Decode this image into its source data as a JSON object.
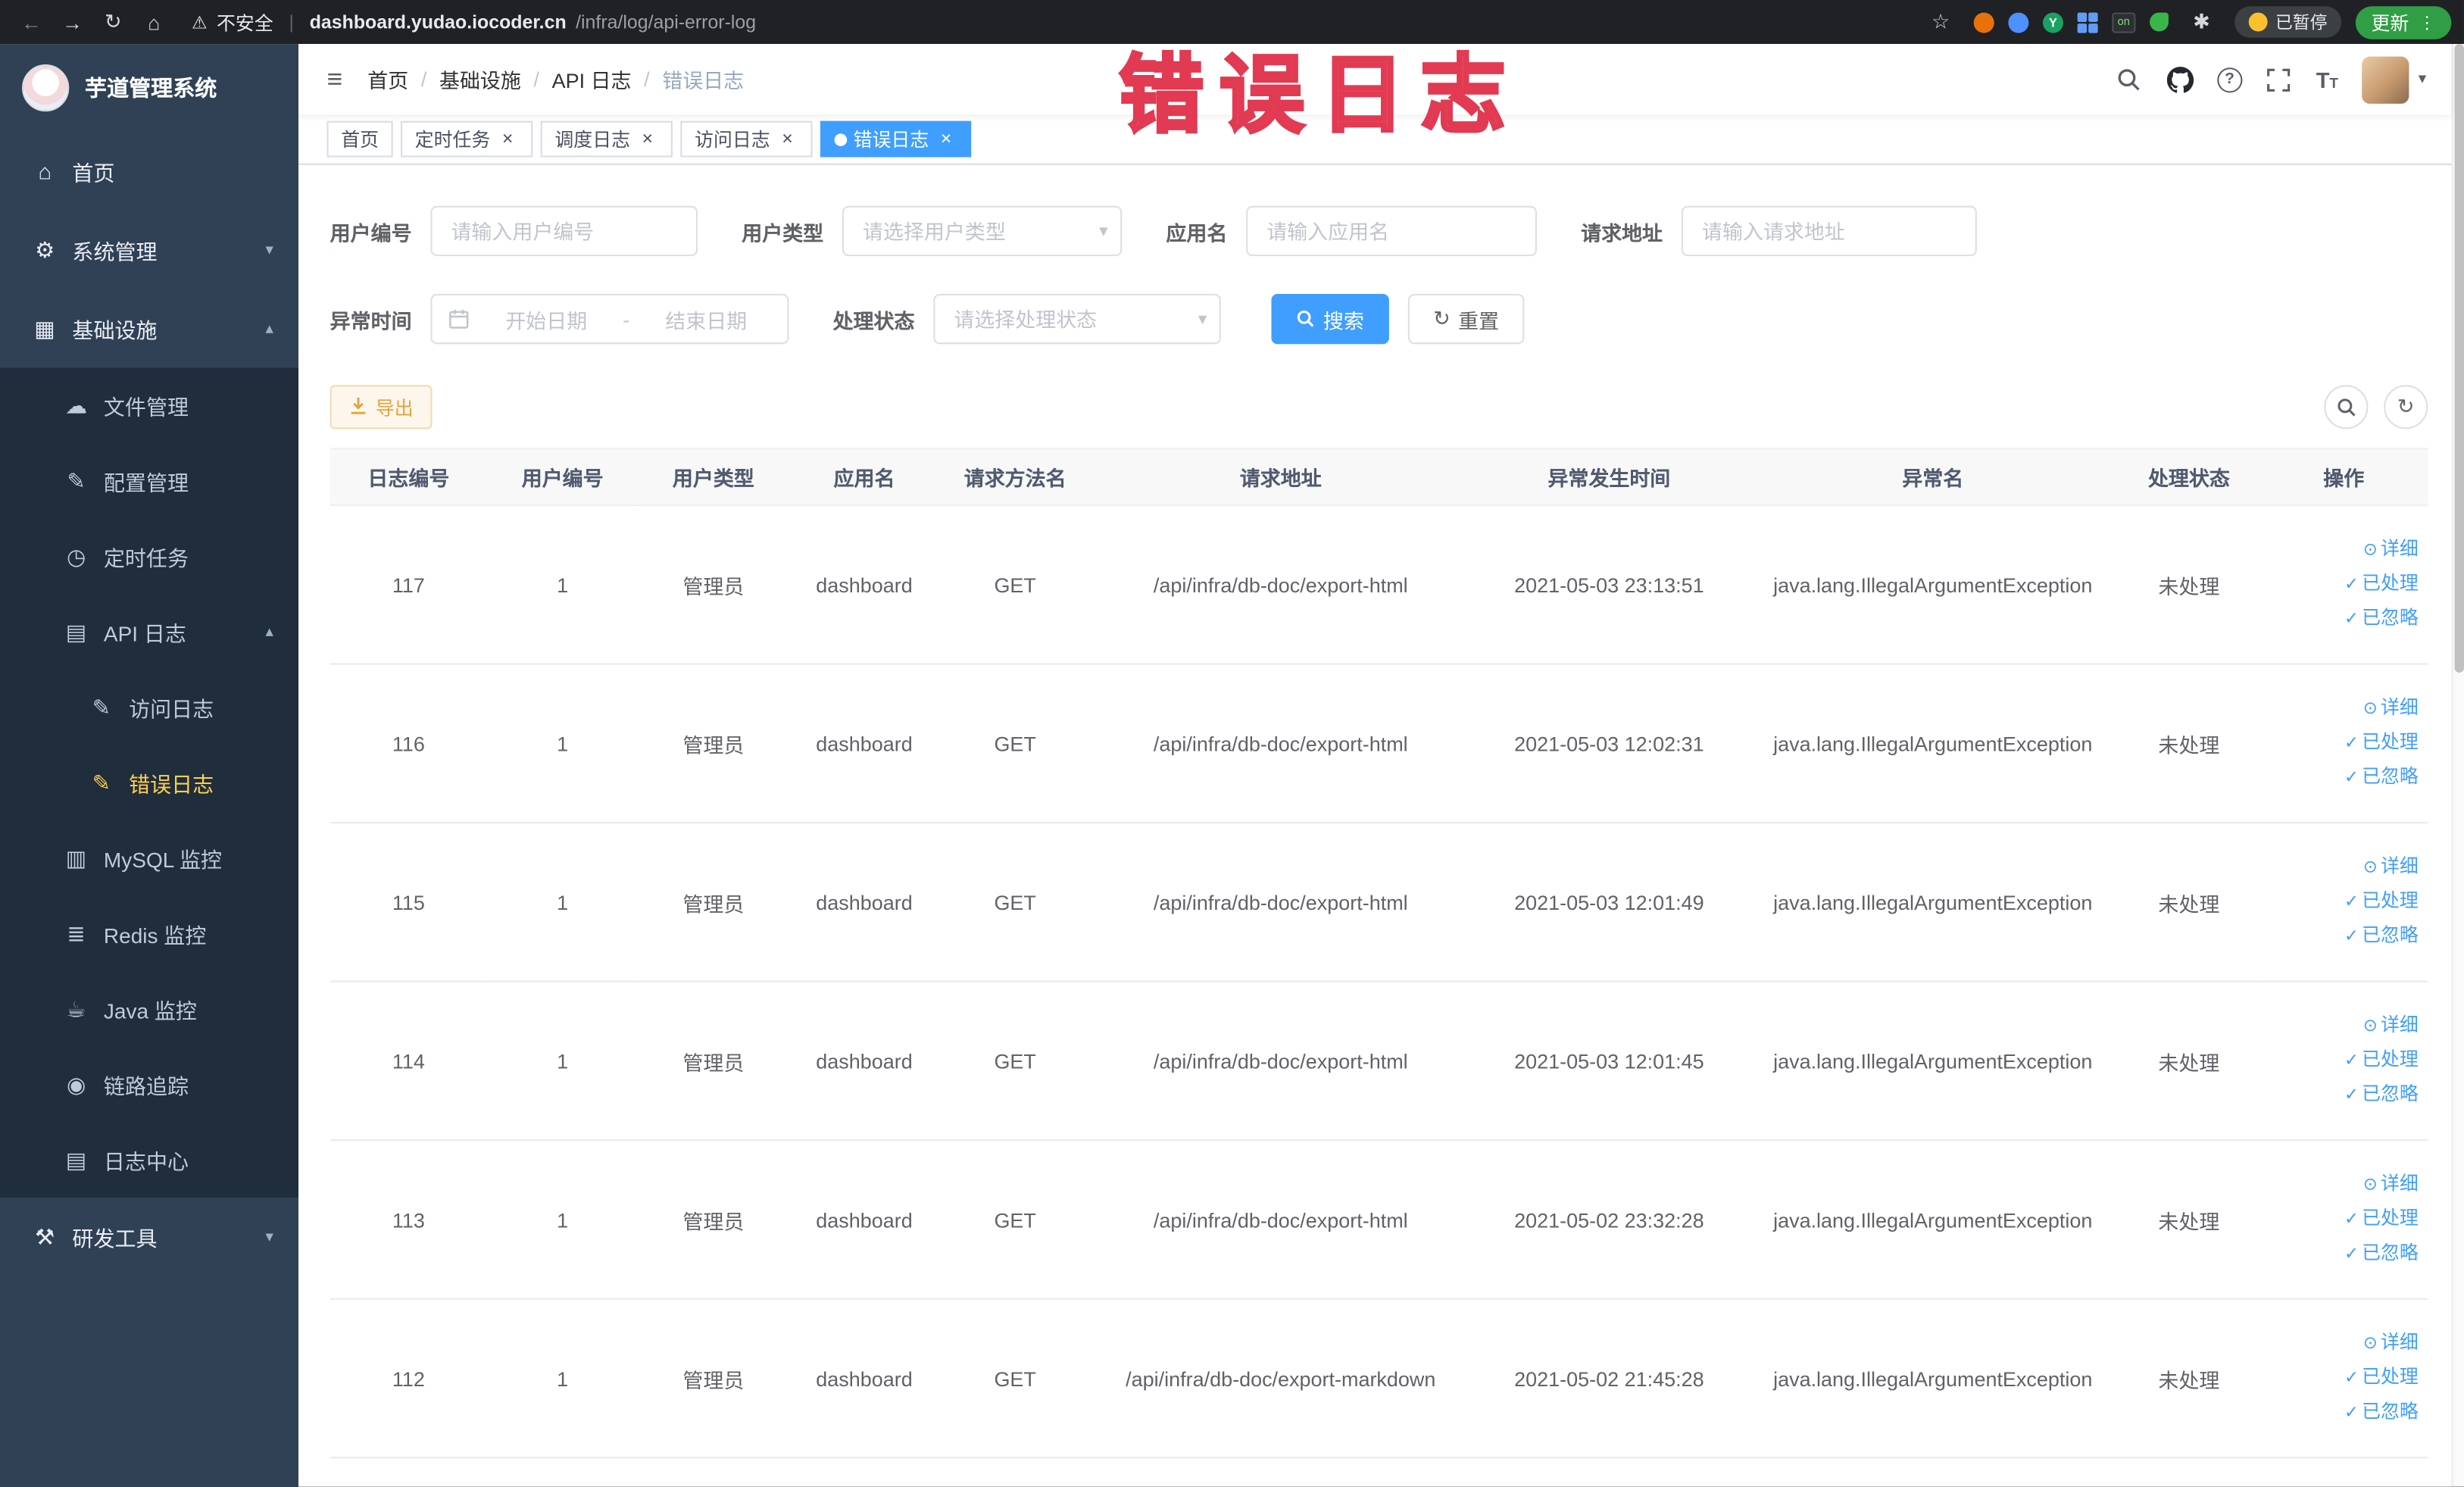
{
  "browser": {
    "security_label": "不安全",
    "divider": "|",
    "url_domain": "dashboard.yudao.iocoder.cn",
    "url_path": "/infra/log/api-error-log",
    "on_badge": "on",
    "paused_badge": "已暂停",
    "update_label": "更新"
  },
  "annotation": {
    "text": "错误日志"
  },
  "sidebar": {
    "logo_title": "芋道管理系统",
    "items": [
      {
        "name": "home",
        "label": "首页",
        "icon": "home-icon",
        "level": 1
      },
      {
        "name": "system-management",
        "label": "系统管理",
        "icon": "gear-icon",
        "level": 1,
        "arrow": "down"
      },
      {
        "name": "infrastructure",
        "label": "基础设施",
        "icon": "infra-icon",
        "level": 1,
        "arrow": "up"
      },
      {
        "name": "file-management",
        "label": "文件管理",
        "icon": "file-icon",
        "level": 2
      },
      {
        "name": "config-management",
        "label": "配置管理",
        "icon": "config-icon",
        "level": 2
      },
      {
        "name": "scheduled-jobs",
        "label": "定时任务",
        "icon": "job-icon",
        "level": 2
      },
      {
        "name": "api-log",
        "label": "API 日志",
        "icon": "api-log-icon",
        "level": 2,
        "arrow": "up"
      },
      {
        "name": "access-log",
        "label": "访问日志",
        "icon": "access-log-icon",
        "level": 3
      },
      {
        "name": "error-log",
        "label": "错误日志",
        "icon": "error-log-icon",
        "level": 3,
        "active": true
      },
      {
        "name": "mysql-monitor",
        "label": "MySQL 监控",
        "icon": "mysql-icon",
        "level": 2
      },
      {
        "name": "redis-monitor",
        "label": "Redis 监控",
        "icon": "redis-icon",
        "level": 2
      },
      {
        "name": "java-monitor",
        "label": "Java 监控",
        "icon": "java-icon",
        "level": 2
      },
      {
        "name": "trace",
        "label": "链路追踪",
        "icon": "trace-icon",
        "level": 2
      },
      {
        "name": "log-center",
        "label": "日志中心",
        "icon": "log-center-icon",
        "level": 2
      },
      {
        "name": "dev-tools",
        "label": "研发工具",
        "icon": "tools-icon",
        "level": 1,
        "arrow": "down"
      }
    ]
  },
  "navbar": {
    "breadcrumb": [
      "首页",
      "基础设施",
      "API 日志",
      "错误日志"
    ],
    "separator": "/"
  },
  "tags": [
    {
      "name": "home",
      "label": "首页",
      "closable": false,
      "active": false
    },
    {
      "name": "scheduled-jobs",
      "label": "定时任务",
      "closable": true,
      "active": false
    },
    {
      "name": "schedule-log",
      "label": "调度日志",
      "closable": true,
      "active": false
    },
    {
      "name": "access-log",
      "label": "访问日志",
      "closable": true,
      "active": false
    },
    {
      "name": "error-log",
      "label": "错误日志",
      "closable": true,
      "active": true
    }
  ],
  "filters": {
    "user_id": {
      "label": "用户编号",
      "placeholder": "请输入用户编号"
    },
    "user_type": {
      "label": "用户类型",
      "placeholder": "请选择用户类型"
    },
    "app_name": {
      "label": "应用名",
      "placeholder": "请输入应用名"
    },
    "request_url": {
      "label": "请求地址",
      "placeholder": "请输入请求地址"
    },
    "exception_time": {
      "label": "异常时间",
      "start_placeholder": "开始日期",
      "separator": "-",
      "end_placeholder": "结束日期"
    },
    "process_status": {
      "label": "处理状态",
      "placeholder": "请选择处理状态"
    },
    "search_button": "搜索",
    "reset_button": "重置"
  },
  "toolbar": {
    "export_label": "导出"
  },
  "table": {
    "columns": [
      "日志编号",
      "用户编号",
      "用户类型",
      "应用名",
      "请求方法名",
      "请求地址",
      "异常发生时间",
      "异常名",
      "处理状态",
      "操作"
    ],
    "action_labels": {
      "detail": "详细",
      "processed": "已处理",
      "ignored": "已忽略"
    },
    "rows": [
      {
        "id": "117",
        "user_id": "1",
        "user_type": "管理员",
        "app": "dashboard",
        "method": "GET",
        "url": "/api/infra/db-doc/export-html",
        "time": "2021-05-03 23:13:51",
        "exception": "java.lang.IllegalArgumentException",
        "status": "未处理"
      },
      {
        "id": "116",
        "user_id": "1",
        "user_type": "管理员",
        "app": "dashboard",
        "method": "GET",
        "url": "/api/infra/db-doc/export-html",
        "time": "2021-05-03 12:02:31",
        "exception": "java.lang.IllegalArgumentException",
        "status": "未处理"
      },
      {
        "id": "115",
        "user_id": "1",
        "user_type": "管理员",
        "app": "dashboard",
        "method": "GET",
        "url": "/api/infra/db-doc/export-html",
        "time": "2021-05-03 12:01:49",
        "exception": "java.lang.IllegalArgumentException",
        "status": "未处理"
      },
      {
        "id": "114",
        "user_id": "1",
        "user_type": "管理员",
        "app": "dashboard",
        "method": "GET",
        "url": "/api/infra/db-doc/export-html",
        "time": "2021-05-03 12:01:45",
        "exception": "java.lang.IllegalArgumentException",
        "status": "未处理"
      },
      {
        "id": "113",
        "user_id": "1",
        "user_type": "管理员",
        "app": "dashboard",
        "method": "GET",
        "url": "/api/infra/db-doc/export-html",
        "time": "2021-05-02 23:32:28",
        "exception": "java.lang.IllegalArgumentException",
        "status": "未处理"
      },
      {
        "id": "112",
        "user_id": "1",
        "user_type": "管理员",
        "app": "dashboard",
        "method": "GET",
        "url": "/api/infra/db-doc/export-markdown",
        "time": "2021-05-02 21:45:28",
        "exception": "java.lang.IllegalArgumentException",
        "status": "未处理"
      }
    ]
  },
  "icons": {
    "back-icon": "←",
    "forward-icon": "→",
    "reload-icon": "↻",
    "browser-home-icon": "⌂",
    "warning-icon": "⚠",
    "bookmark-star-icon": "☆",
    "browser-menu-icon": "⋮",
    "paw-icon": "✱",
    "hamburger-icon": "≡",
    "help-icon": "?",
    "font-size-large": "T",
    "font-size-small": "T",
    "caret-down-icon": "▾",
    "arrow-down-icon": "▾",
    "arrow-up-icon": "▴",
    "close-icon": "×",
    "home-icon": "⌂",
    "gear-icon": "⚙",
    "infra-icon": "▦",
    "file-icon": "☁",
    "config-icon": "✎",
    "job-icon": "◷",
    "api-log-icon": "▤",
    "access-log-icon": "✎",
    "error-log-icon": "✎",
    "mysql-icon": "▥",
    "redis-icon": "≣",
    "java-icon": "☕",
    "trace-icon": "◉",
    "log-center-icon": "▤",
    "tools-icon": "⚒",
    "refresh-icon": "↻",
    "detail-icon": "⊙",
    "check-icon": "✓"
  }
}
